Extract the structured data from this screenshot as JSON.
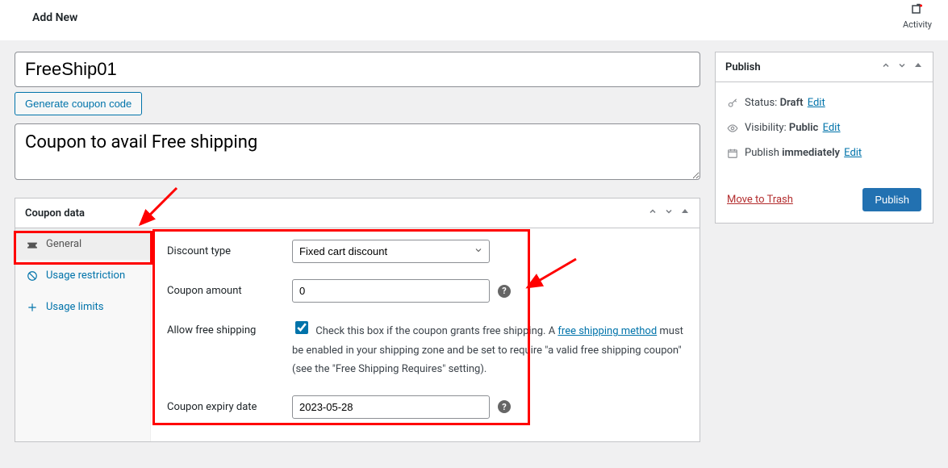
{
  "header": {
    "page_title": "Add New",
    "activity_label": "Activity"
  },
  "coupon": {
    "code": "FreeShip01",
    "generate_button": "Generate coupon code",
    "description": "Coupon to avail Free shipping"
  },
  "data_panel": {
    "title": "Coupon data",
    "tabs": [
      {
        "label": "General"
      },
      {
        "label": "Usage restriction"
      },
      {
        "label": "Usage limits"
      }
    ],
    "fields": {
      "discount_type_label": "Discount type",
      "discount_type_value": "Fixed cart discount",
      "amount_label": "Coupon amount",
      "amount_value": "0",
      "free_ship_label": "Allow free shipping",
      "free_ship_checked": true,
      "free_ship_desc_pre": "Check this box if the coupon grants free shipping. A ",
      "free_ship_link": "free shipping method",
      "free_ship_desc_post": " must be enabled in your shipping zone and be set to require \"a valid free shipping coupon\" (see the \"Free Shipping Requires\" setting).",
      "expiry_label": "Coupon expiry date",
      "expiry_value": "2023-05-28"
    }
  },
  "publish_panel": {
    "title": "Publish",
    "status_label": "Status:",
    "status_value": "Draft",
    "visibility_label": "Visibility:",
    "visibility_value": "Public",
    "schedule_label": "Publish",
    "schedule_value": "immediately",
    "edit_label": "Edit",
    "trash_label": "Move to Trash",
    "publish_button": "Publish"
  }
}
